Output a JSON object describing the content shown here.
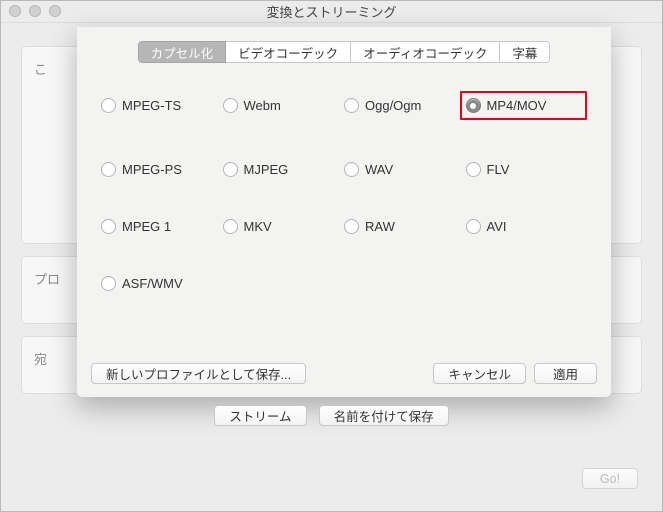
{
  "window": {
    "title": "変換とストリーミング"
  },
  "bg": {
    "sources_label": "こ",
    "profile_label": "プロ",
    "dest_label": "宛"
  },
  "tabs": [
    {
      "label": "カプセル化",
      "active": true
    },
    {
      "label": "ビデオコーデック",
      "active": false
    },
    {
      "label": "オーディオコーデック",
      "active": false
    },
    {
      "label": "字幕",
      "active": false
    }
  ],
  "formats": [
    {
      "label": "MPEG-TS",
      "selected": false
    },
    {
      "label": "Webm",
      "selected": false
    },
    {
      "label": "Ogg/Ogm",
      "selected": false
    },
    {
      "label": "MP4/MOV",
      "selected": true,
      "highlighted": true
    },
    {
      "label": "MPEG-PS",
      "selected": false
    },
    {
      "label": "MJPEG",
      "selected": false
    },
    {
      "label": "WAV",
      "selected": false
    },
    {
      "label": "FLV",
      "selected": false
    },
    {
      "label": "MPEG 1",
      "selected": false
    },
    {
      "label": "MKV",
      "selected": false
    },
    {
      "label": "RAW",
      "selected": false
    },
    {
      "label": "AVI",
      "selected": false
    },
    {
      "label": "ASF/WMV",
      "selected": false
    }
  ],
  "buttons": {
    "save_profile": "新しいプロファイルとして保存...",
    "cancel": "キャンセル",
    "apply": "適用",
    "stream": "ストリーム",
    "save_as": "名前を付けて保存",
    "go": "Go!"
  }
}
